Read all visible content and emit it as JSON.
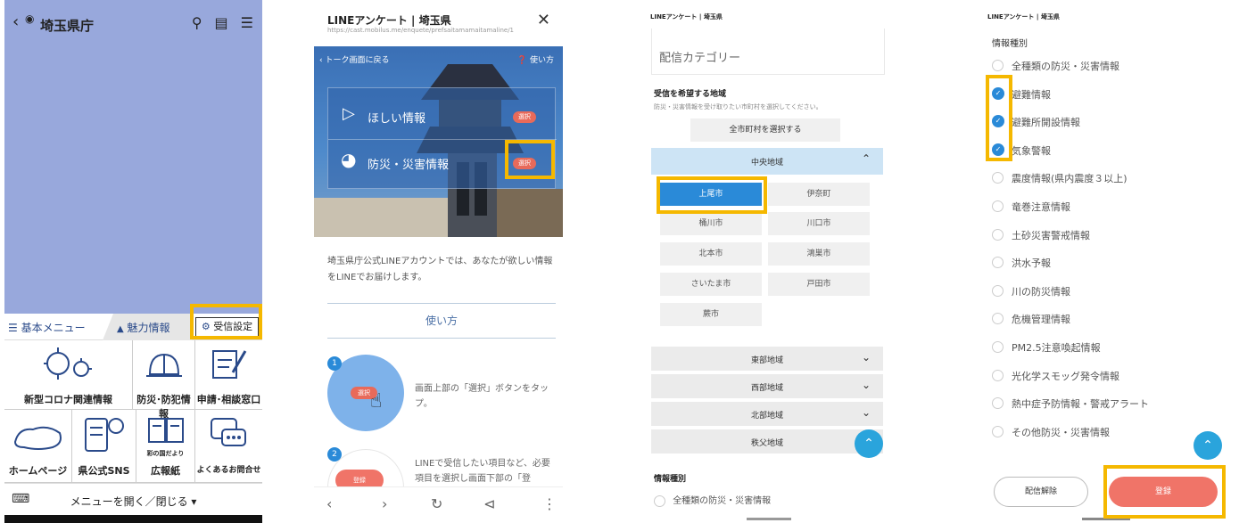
{
  "panel1": {
    "back_icon": "chevron-left-icon",
    "title": "埼玉県庁",
    "top_icons": [
      "search-icon",
      "notebook-icon",
      "menu-icon"
    ],
    "tab_basic": "☰ 基本メニュー",
    "tab_charm": "魅力情報",
    "tab_receive": "受信設定",
    "grid": [
      {
        "label": "新型コロナ関連情報"
      },
      {
        "label": "防災･防犯情報"
      },
      {
        "label": "申請･相談窓口"
      },
      {
        "label": "ホームページ"
      },
      {
        "label": "県公式SNS"
      },
      {
        "label": "広報紙"
      },
      {
        "label": "よくあるお問合せ"
      }
    ],
    "kouhoushi_sub": "彩の国だより",
    "menu_toggle": "メニューを開く／閉じる ▾"
  },
  "panel2": {
    "title": "LINEアンケート | 埼玉県",
    "url": "https://cast.mobilus.me/enquete/prefsaitamamaitamaline/1",
    "back_link": "トーク画面に戻る",
    "help": "使い方",
    "row1_label": "ほしい情報",
    "row2_label": "防災・災害情報",
    "select": "選択",
    "intro": "埼玉県庁公式LINEアカウントでは、あなたが欲しい情報をLINEでお届けします。",
    "how_to": "使い方",
    "step1_num": "1",
    "step1_btn": "選択",
    "step1_text": "画面上部の「選択」ボタンをタップ。",
    "step2_num": "2",
    "step2_btn": "登録",
    "step2_text": "LINEで受信したい項目など、必要項目を選択し画面下部の「登"
  },
  "panel3": {
    "header": "LINEアンケート | 埼玉県",
    "category": "配信カテゴリー",
    "area_title": "受信を希望する地域",
    "area_note": "防災・災害情報を受け取りたい市町村を選択してください。",
    "select_all": "全市町村を選択する",
    "region_central": "中央地域",
    "cities": [
      "上尾市",
      "伊奈町",
      "桶川市",
      "川口市",
      "北本市",
      "鴻巣市",
      "さいたま市",
      "戸田市",
      "蕨市"
    ],
    "regions_collapsed": [
      "東部地域",
      "西部地域",
      "北部地域",
      "秩父地域"
    ],
    "info_type": "情報種別",
    "first_option": "全種類の防災・災害情報"
  },
  "panel4": {
    "header": "LINEアンケート | 埼玉県",
    "section": "情報種別",
    "options": [
      {
        "label": "全種類の防災・災害情報",
        "checked": false
      },
      {
        "label": "避難情報",
        "checked": true
      },
      {
        "label": "避難所開設情報",
        "checked": true
      },
      {
        "label": "気象警報",
        "checked": true
      },
      {
        "label": "震度情報(県内震度３以上)",
        "checked": false
      },
      {
        "label": "竜巻注意情報",
        "checked": false
      },
      {
        "label": "土砂災害警戒情報",
        "checked": false
      },
      {
        "label": "洪水予報",
        "checked": false
      },
      {
        "label": "川の防災情報",
        "checked": false
      },
      {
        "label": "危機管理情報",
        "checked": false
      },
      {
        "label": "PM2.5注意喚起情報",
        "checked": false
      },
      {
        "label": "光化学スモッグ発令情報",
        "checked": false
      },
      {
        "label": "熱中症予防情報・警戒アラート",
        "checked": false
      },
      {
        "label": "その他防災・災害情報",
        "checked": false
      }
    ],
    "unsubscribe": "配信解除",
    "register": "登録"
  },
  "colors": {
    "accent": "#f5b800",
    "line_blue": "#2aa4dc",
    "check_blue": "#2a8ad8",
    "cta": "#f07468"
  }
}
